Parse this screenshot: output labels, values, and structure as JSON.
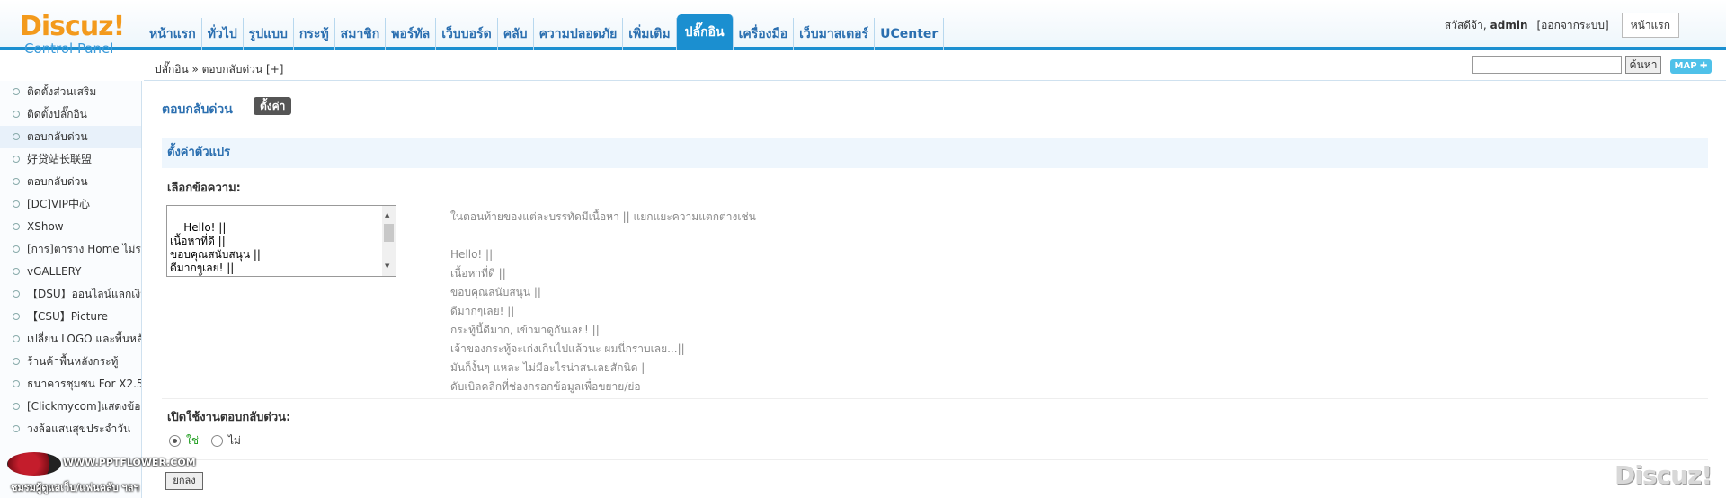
{
  "header": {
    "logo_brand": "Discuz!",
    "logo_sub": "Control Panel",
    "nav": [
      "หน้าแรก",
      "ทั่วไป",
      "รูปแบบ",
      "กระทู้",
      "สมาชิก",
      "พอร์ทัล",
      "เว็บบอร์ด",
      "คลับ",
      "ความปลอดภัย",
      "เพิ่มเติม",
      "ปลั๊กอิน",
      "เครื่องมือ",
      "เว็บมาสเตอร์",
      "UCenter"
    ],
    "active_nav": "ปลั๊กอิน",
    "greeting": "สวัสดีจ้า,",
    "username": "admin",
    "logout": "[ออกจากระบบ]",
    "home_button": "หน้าแรก"
  },
  "breadcrumb": "ปลั๊กอิน » ตอบกลับด่วน  [+]",
  "search": {
    "button": "ค้นหา",
    "value": ""
  },
  "map_button": "MAP ✚",
  "sidebar": {
    "items": [
      "ติดตั้งส่วนเสริม",
      "ติดตั้งปลั๊กอิน",
      "ตอบกลับด่วน",
      "好贷站长联盟",
      "ตอบกลับด่วน",
      "[DC]VIP中心",
      "XShow",
      "[การ]ตาราง Home ไม่ระบุ",
      "vGALLERY",
      "【DSU】ออนไลน์แลกเงิน",
      "【CSU】Picture",
      "เปลี่ยน LOGO และพื้นหลัง",
      "ร้านค้าพื้นหลังกระทู้",
      "ธนาคารชุมชน For X2.5",
      "[Clickmycom]แสดงข้อความ",
      "วงล้อแสนสุขประจำวัน"
    ],
    "active_index": 2
  },
  "content": {
    "plugin_title": "ตอบกลับด่วน",
    "tab_settings": "ตั้งค่า",
    "section_title": "ตั้งค่าตัวแปร",
    "field1_label": "เลือกข้อความ:",
    "textarea_value": "Hello! ||\nเนื้อหาที่ดี ||\nขอบคุณสนับสนุน ||\nดีมากๆเลย! ||\nกระทู้นี้ดีมาก, เข้ามาดูกันเลย! ||",
    "help_lines": [
      "ในตอนท้ายของแต่ละบรรทัดมีเนื้อหา || แยกแยะความแตกต่างเช่น",
      "",
      "Hello! ||",
      "เนื้อหาที่ดี ||",
      "ขอบคุณสนับสนุน ||",
      "ดีมากๆเลย! ||",
      "กระทู้นี้ดีมาก, เข้ามาดูกันเลย! ||",
      "เจ้าของกระทู้จะเก่งเกินไปแล้วนะ ผมนี่กราบเลย...||",
      "มันก็งั้นๆ แหละ ไม่มีอะไรน่าสนเลยสักนิด |",
      "ดับเบิลคลิกที่ช่องกรอกข้อมูลเพื่อขยาย/ย่อ"
    ],
    "field2_label": "เปิดใช้งานตอบกลับด่วน:",
    "radio_yes": "ใช่",
    "radio_no": "ไม่",
    "submit": "ยกลง"
  },
  "watermark": {
    "site": "WWW.PPTFLOWER.COM",
    "text": "ชมรมผู้ดูแลเว็บ/แฟนคลับ ฯลฯ"
  },
  "footer_logo": "Discuz!"
}
